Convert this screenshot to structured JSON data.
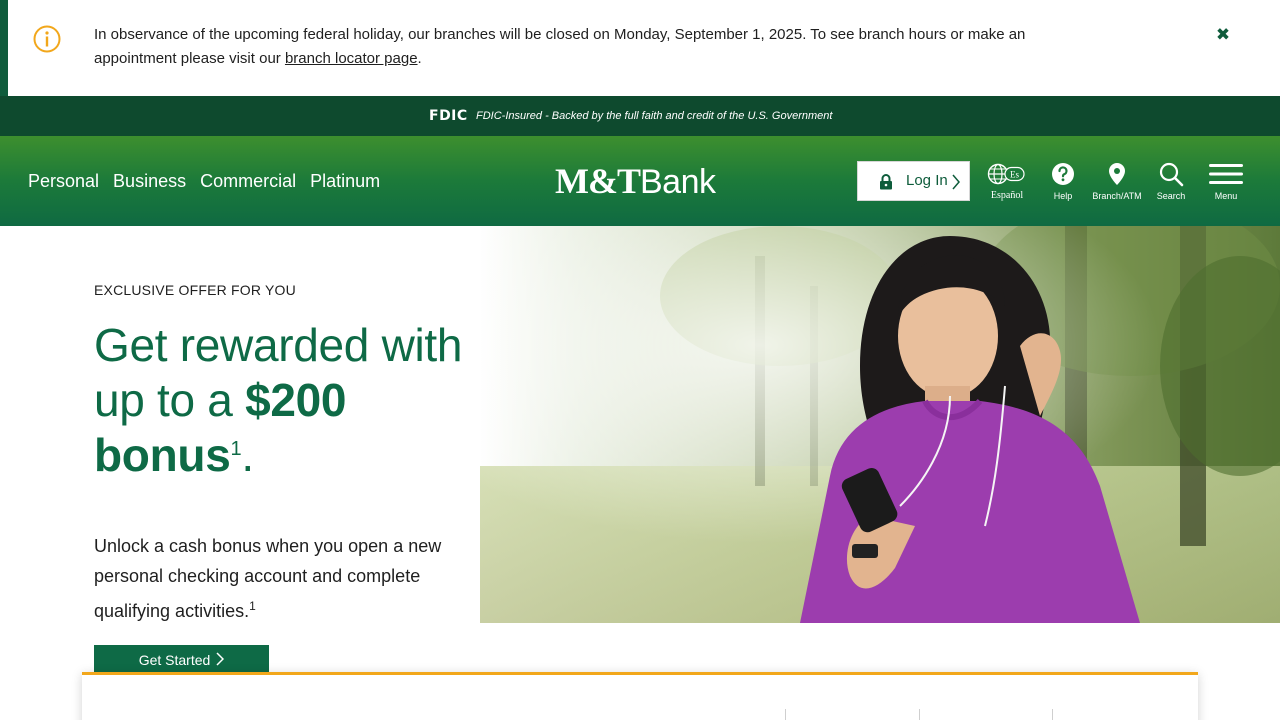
{
  "alert": {
    "icon": "info-circle-icon",
    "message_before": "In observance of the upcoming federal holiday, our branches will be closed on Monday, September 1, 2025. To see branch hours or make an appointment please visit our ",
    "link_text": "branch locator page",
    "message_after": ".",
    "close_icon": "close-icon",
    "accent_color": "#f2a71b"
  },
  "fdic": {
    "logo": "FDIC",
    "text": "FDIC-Insured - Backed by the full faith and credit of the U.S. Government"
  },
  "header": {
    "nav": [
      "Personal",
      "Business",
      "Commercial",
      "Platinum"
    ],
    "logo_mt": "M&T",
    "logo_bank": "Bank",
    "login_label": "Log In",
    "utilities": [
      {
        "icon": "globe-icon",
        "badge": "Es",
        "label": "Español"
      },
      {
        "icon": "help-icon",
        "label": "Help"
      },
      {
        "icon": "location-pin-icon",
        "label": "Branch/ATM"
      },
      {
        "icon": "search-icon",
        "label": "Search"
      },
      {
        "icon": "hamburger-menu-icon",
        "label": "Menu"
      }
    ],
    "brand_color": "#0e6a46"
  },
  "hero": {
    "eyebrow": "EXCLUSIVE OFFER FOR YOU",
    "headline_part1": "Get rewarded with up to a ",
    "headline_bold1": "$200",
    "headline_bold2": "bonus",
    "headline_sup": "1",
    "headline_end": ".",
    "body": "Unlock a cash bonus when you open a new personal checking account and complete qualifying activities.",
    "body_sup": "1",
    "cta_label": "Get Started"
  }
}
